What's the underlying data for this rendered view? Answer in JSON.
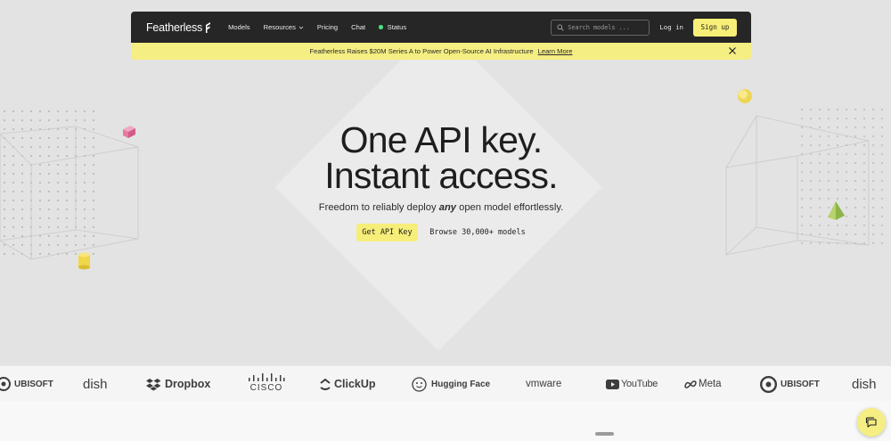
{
  "brand": {
    "name": "Featherless"
  },
  "nav": {
    "links": [
      {
        "label": "Models"
      },
      {
        "label": "Resources"
      },
      {
        "label": "Pricing"
      },
      {
        "label": "Chat"
      },
      {
        "label": "Status"
      }
    ],
    "search_placeholder": "Search models ...",
    "login_label": "Log in",
    "signup_label": "Sign up"
  },
  "banner": {
    "text": "Featherless Raises $20M Series A to Power Open-Source AI Infrastructure",
    "link_label": "Learn More"
  },
  "hero": {
    "headline_line1": "One API key.",
    "headline_line2": "Instant access.",
    "subtitle_pre": "Freedom to reliably deploy ",
    "subtitle_em": "any",
    "subtitle_post": " open model effortlessly.",
    "cta_primary": "Get API Key",
    "cta_secondary": "Browse 30,000+ models"
  },
  "logos": [
    {
      "name": "UBISOFT",
      "icon": "ubisoft-logo"
    },
    {
      "name": "dish",
      "icon": "dish-logo"
    },
    {
      "name": "Dropbox",
      "icon": "dropbox-logo"
    },
    {
      "name": "CISCO",
      "icon": "cisco-logo"
    },
    {
      "name": "ClickUp",
      "icon": "clickup-logo"
    },
    {
      "name": "Hugging Face",
      "icon": "hugging-face-logo"
    },
    {
      "name": "vmware",
      "icon": "vmware-logo"
    },
    {
      "name": "YouTube",
      "icon": "youtube-logo"
    },
    {
      "name": "Meta",
      "icon": "meta-logo"
    },
    {
      "name": "UBISOFT",
      "icon": "ubisoft-logo"
    },
    {
      "name": "dish",
      "icon": "dish-logo"
    }
  ],
  "colors": {
    "accent_yellow": "#f7ee7a",
    "nav_bg": "#262626",
    "status_green": "#4ade80",
    "hero_bg": "#e3e3e3"
  }
}
